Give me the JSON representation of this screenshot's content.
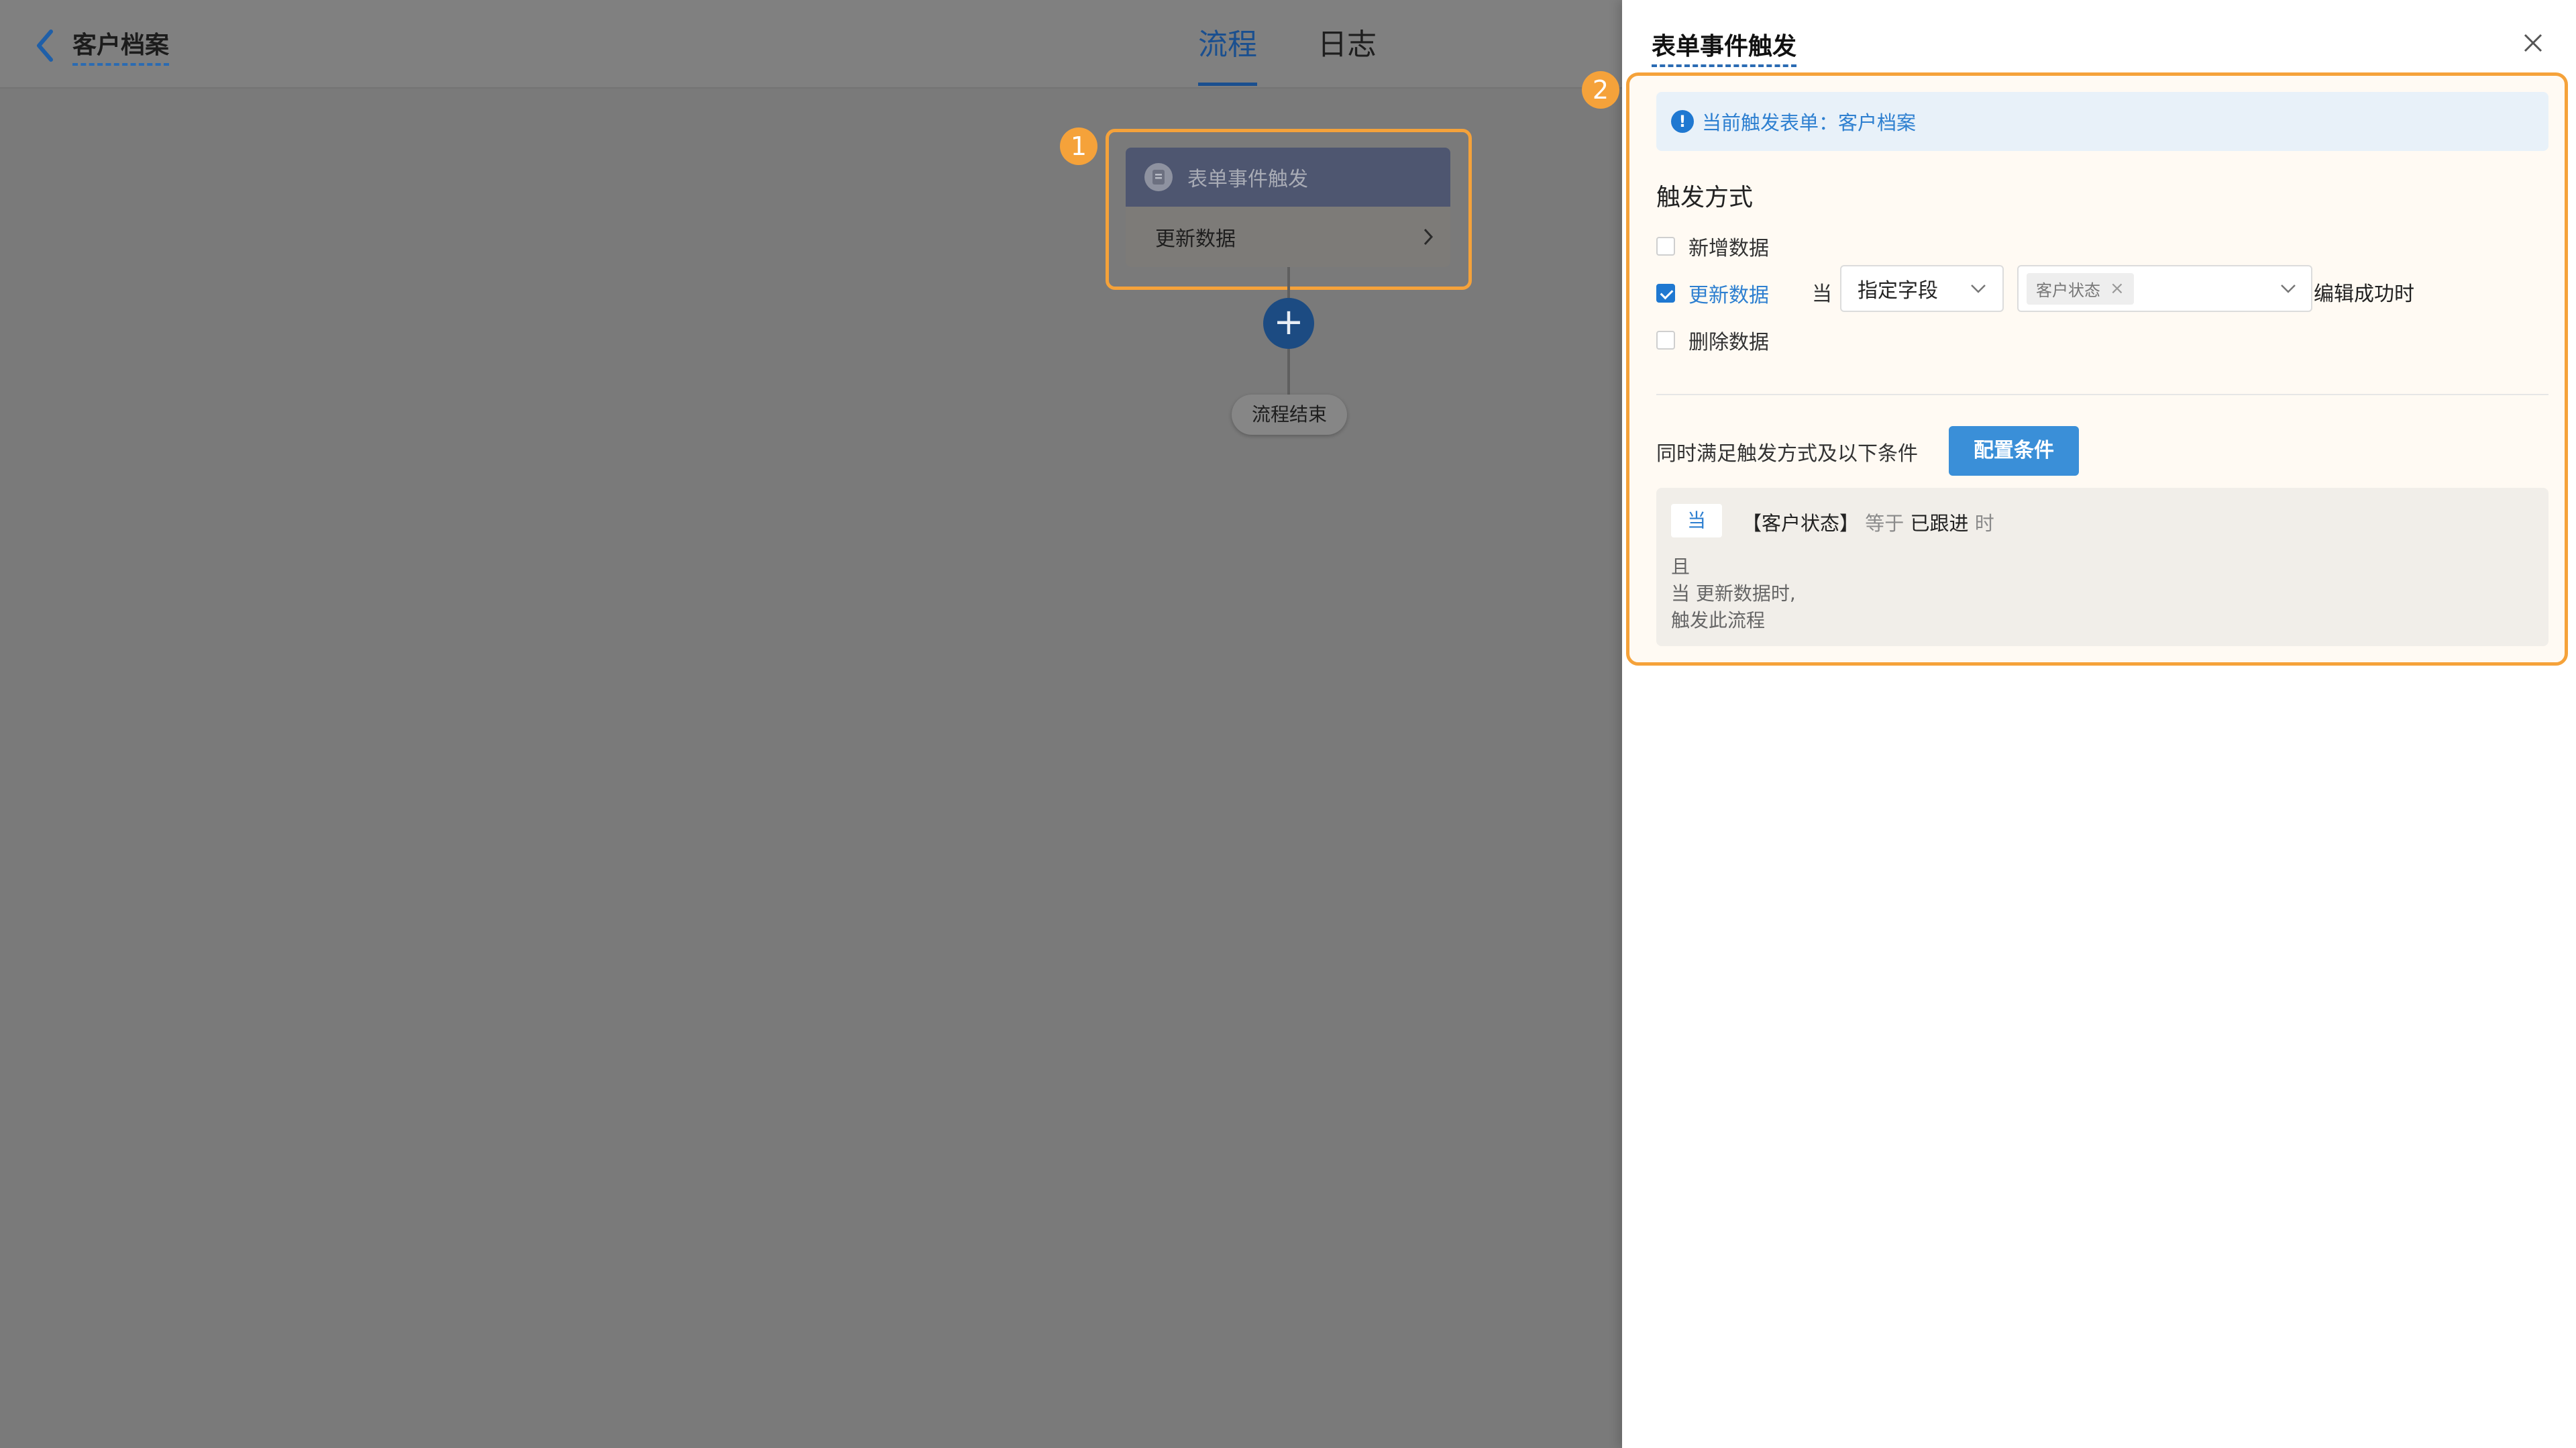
{
  "header": {
    "back_title": "客户档案",
    "tabs": [
      {
        "label": "流程",
        "active": true
      },
      {
        "label": "日志",
        "active": false
      }
    ]
  },
  "flow": {
    "node_title": "表单事件触发",
    "node_subtitle": "更新数据",
    "add_symbol": "+",
    "end_label": "流程结束",
    "badge_1": "1"
  },
  "drawer": {
    "title": "表单事件触发",
    "badge_2": "2",
    "info_text": "当前触发表单：客户档案",
    "trigger_section": "触发方式",
    "options": [
      {
        "label": "新增数据",
        "checked": false
      },
      {
        "label": "更新数据",
        "checked": true
      },
      {
        "label": "删除数据",
        "checked": false
      }
    ],
    "when_label": "当",
    "field_select": "指定字段",
    "field_tag": "客户状态",
    "after_label": "编辑成功时",
    "condition_label": "同时满足触发方式及以下条件",
    "config_button": "配置条件",
    "condition_box": {
      "when_chip": "当",
      "field": "【客户状态】",
      "operator": "等于",
      "value": "已跟进",
      "suffix": "时",
      "and": "且",
      "line2": "当 更新数据时,",
      "line3": "触发此流程"
    }
  },
  "colors": {
    "accent": "#1f78d1",
    "highlight": "#f5a23a",
    "node_header": "#4e5670"
  }
}
